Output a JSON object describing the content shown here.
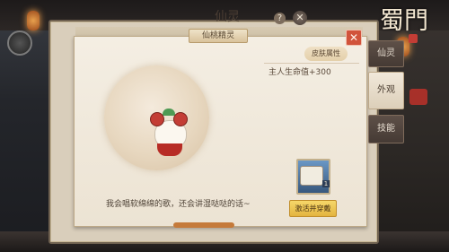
{
  "window": {
    "title": "仙灵"
  },
  "dialog": {
    "title": "仙桃精灵",
    "speech": "我会唱软绵绵的歌，还会讲湿哒哒的话~",
    "attr_title": "皮肤属性",
    "attr_value": "主人生命值+300",
    "item_count": "1",
    "activate_button": "激活并穿戴"
  },
  "tabs": [
    {
      "label": "仙灵"
    },
    {
      "label": "外观"
    },
    {
      "label": "技能"
    }
  ],
  "logo": {
    "text": "蜀門"
  }
}
